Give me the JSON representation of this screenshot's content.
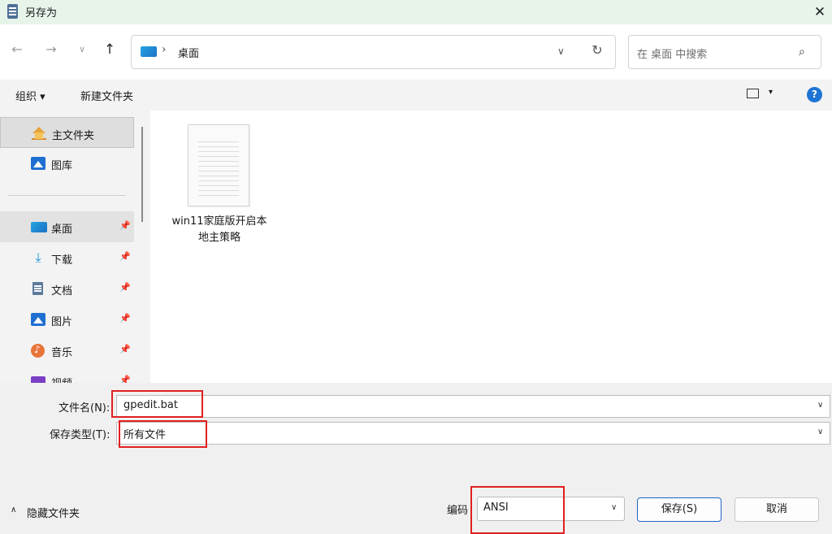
{
  "window": {
    "title": "另存为",
    "close_glyph": "✕"
  },
  "nav": {
    "back_glyph": "←",
    "forward_glyph": "→",
    "recent_glyph": "∨",
    "up_glyph": "↑",
    "address_separator": "›",
    "address_location": "桌面",
    "address_chevron": "∨",
    "refresh_glyph": "↻",
    "search_placeholder": "在 桌面 中搜索",
    "search_glyph": "⌕"
  },
  "toolbar": {
    "organize_label": "组织 ▾",
    "new_folder_label": "新建文件夹",
    "view_chevron": "▾",
    "help_label": "?"
  },
  "sidebar": {
    "items": [
      {
        "label": "主文件夹",
        "icon": "home-icon",
        "pinned": false
      },
      {
        "label": "图库",
        "icon": "gallery-icon",
        "pinned": false
      },
      {
        "label": "桌面",
        "icon": "desktop-icon",
        "pinned": true
      },
      {
        "label": "下载",
        "icon": "download-icon",
        "pinned": true
      },
      {
        "label": "文档",
        "icon": "document-icon",
        "pinned": true
      },
      {
        "label": "图片",
        "icon": "pictures-icon",
        "pinned": true
      },
      {
        "label": "音乐",
        "icon": "music-icon",
        "pinned": true
      },
      {
        "label": "视频",
        "icon": "video-icon",
        "pinned": true
      }
    ],
    "pin_glyph": "📌",
    "download_glyph": "⤓"
  },
  "content": {
    "files": [
      {
        "name": "win11家庭版开启本地主策略",
        "icon": "text-file-icon"
      }
    ]
  },
  "form": {
    "filename_label": "文件名(N):",
    "filename_value": "gpedit.bat",
    "type_label": "保存类型(T):",
    "type_value": "所有文件",
    "dropdown_chevron": "∨"
  },
  "footer": {
    "hide_folders_chevron": "∧",
    "hide_folders_label": "隐藏文件夹",
    "encoding_label": "编码",
    "encoding_value": "ANSI",
    "save_label": "保存(S)",
    "cancel_label": "取消"
  },
  "colors": {
    "title_bar": "#e6f4ea",
    "accent": "#1f62c4",
    "highlight": "#e02020"
  }
}
